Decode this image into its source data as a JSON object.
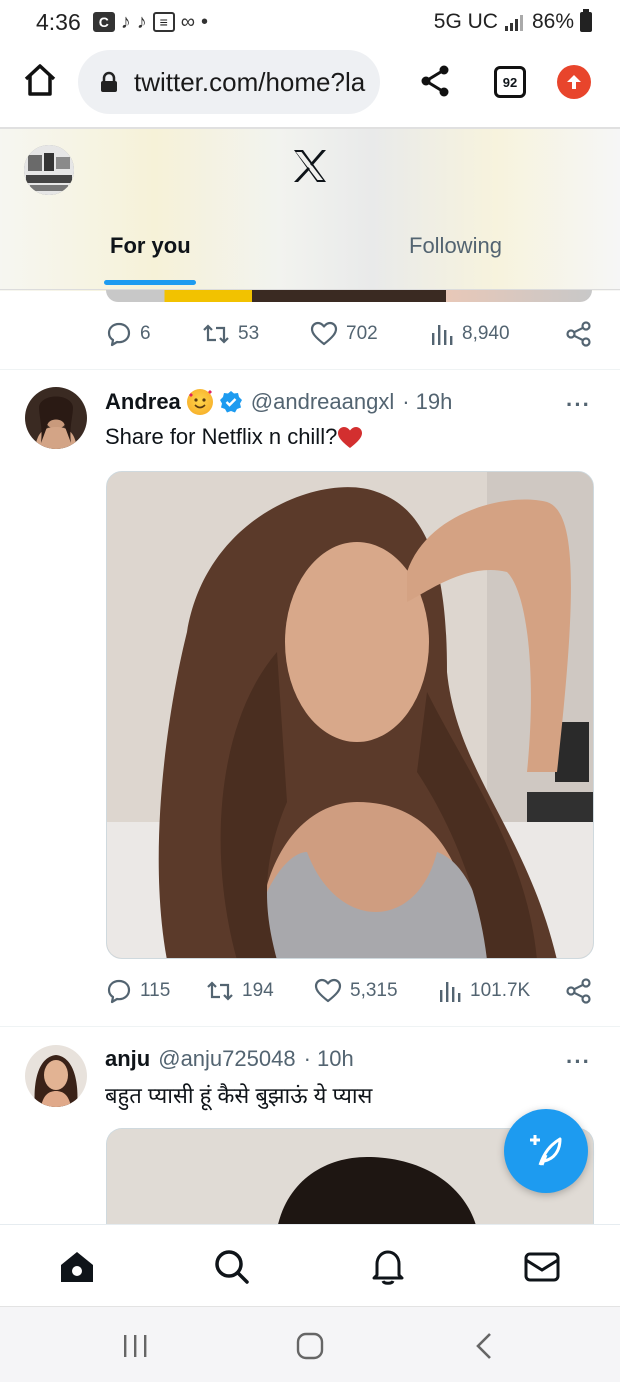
{
  "status_bar": {
    "time": "4:36",
    "network": "5G UC",
    "battery": "86%"
  },
  "browser": {
    "url": "twitter.com/home?la",
    "tab_count": "92"
  },
  "header": {
    "tabs": [
      {
        "label": "For you",
        "active": true
      },
      {
        "label": "Following",
        "active": false
      }
    ]
  },
  "prev_tweet": {
    "replies": "6",
    "retweets": "53",
    "likes": "702",
    "views": "8,940"
  },
  "tweet1": {
    "name": "Andrea",
    "handle": "@andreaangxl",
    "time": "· 19h",
    "text": "Share for Netflix n chill?",
    "replies": "115",
    "retweets": "194",
    "likes": "5,315",
    "views": "101.7K"
  },
  "tweet2": {
    "name": "anju",
    "handle": "@anju725048",
    "time": "· 10h",
    "text": "बहुत प्यासी हूं कैसे बुझाऊं ये प्यास"
  },
  "colors": {
    "accent": "#1d9bf0",
    "secondary_text": "#536471",
    "heart": "#d32f2f"
  },
  "icons": [
    "home-icon",
    "search-icon",
    "notifications-icon",
    "messages-icon",
    "compose-icon",
    "reply-icon",
    "retweet-icon",
    "like-icon",
    "views-icon",
    "share-icon"
  ]
}
